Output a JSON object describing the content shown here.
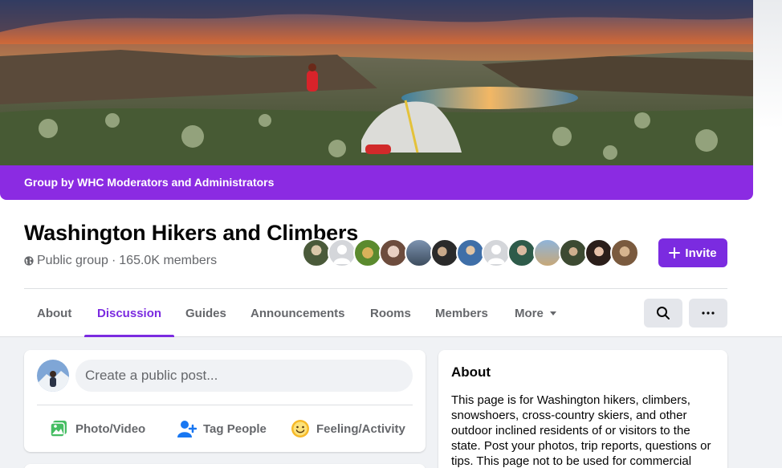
{
  "cover": {
    "banner_text": "Group by WHC Moderators and Administrators",
    "banner_color": "#8b2be2"
  },
  "group": {
    "name": "Washington Hikers and Climbers",
    "privacy": "Public group",
    "separator": "·",
    "members": "165.0K members",
    "privacy_icon": "globe-icon"
  },
  "invite": {
    "label": "Invite",
    "icon": "plus-icon"
  },
  "tabs": [
    {
      "label": "About",
      "active": false
    },
    {
      "label": "Discussion",
      "active": true
    },
    {
      "label": "Guides",
      "active": false
    },
    {
      "label": "Announcements",
      "active": false
    },
    {
      "label": "Rooms",
      "active": false
    },
    {
      "label": "Members",
      "active": false
    },
    {
      "label": "More",
      "active": false
    }
  ],
  "toolbar_icons": [
    "search-icon",
    "more-options-icon"
  ],
  "composer": {
    "placeholder": "Create a public post...",
    "actions": [
      {
        "label": "Photo/Video",
        "icon": "photo-video-icon",
        "color": "#45bd62"
      },
      {
        "label": "Tag People",
        "icon": "tag-people-icon",
        "color": "#1877f2"
      },
      {
        "label": "Feeling/Activity",
        "icon": "feeling-icon",
        "color": "#f7b928"
      }
    ]
  },
  "about": {
    "title": "About",
    "text": "This page is for Washington hikers, climbers, snowshoers, cross-country skiers, and other outdoor inclined residents of or visitors to the state. Post your photos, trip reports, questions or tips. This page not to be used for commercial"
  },
  "colors": {
    "accent": "#7b2be0",
    "muted_text": "#65676b",
    "background": "#f0f2f5"
  }
}
